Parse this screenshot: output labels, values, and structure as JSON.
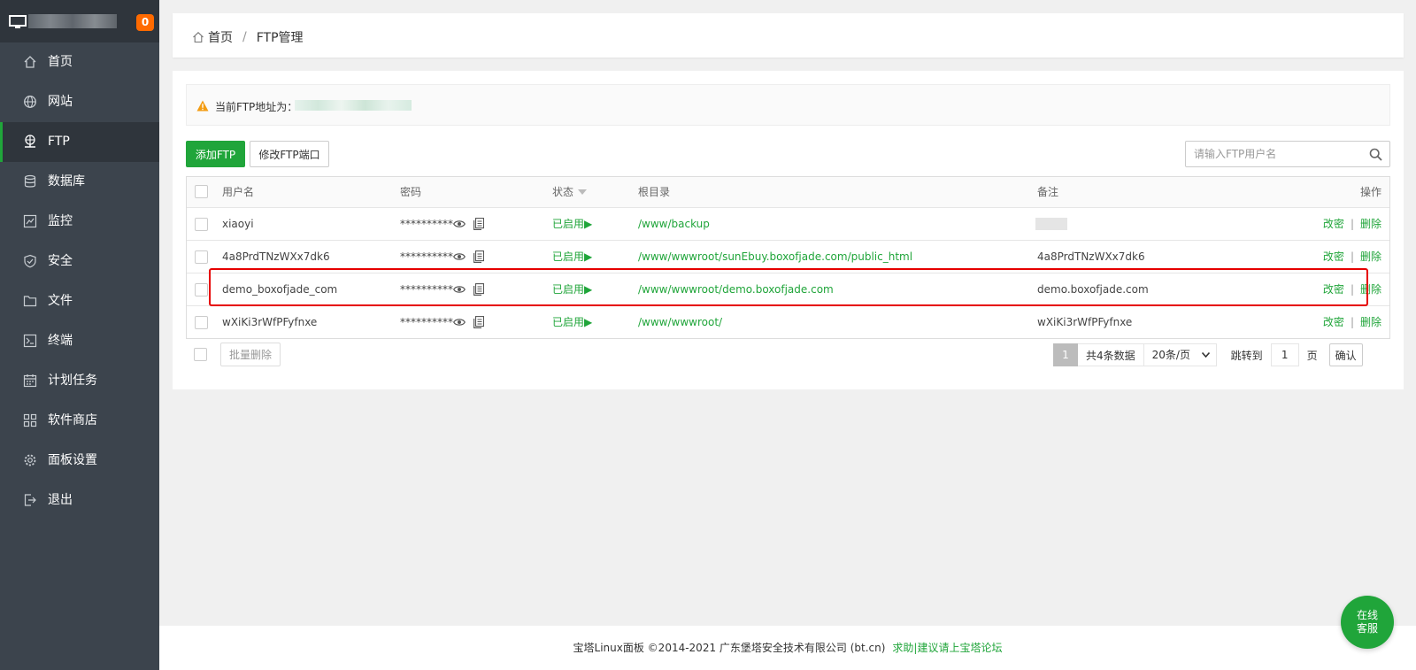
{
  "sidebar": {
    "badge": "0",
    "items": [
      {
        "label": "首页",
        "icon": "home-icon"
      },
      {
        "label": "网站",
        "icon": "globe-icon"
      },
      {
        "label": "FTP",
        "icon": "ftp-icon",
        "active": true
      },
      {
        "label": "数据库",
        "icon": "database-icon"
      },
      {
        "label": "监控",
        "icon": "monitor-chart-icon"
      },
      {
        "label": "安全",
        "icon": "shield-icon"
      },
      {
        "label": "文件",
        "icon": "folder-icon"
      },
      {
        "label": "终端",
        "icon": "terminal-icon"
      },
      {
        "label": "计划任务",
        "icon": "calendar-icon"
      },
      {
        "label": "软件商店",
        "icon": "apps-icon"
      },
      {
        "label": "面板设置",
        "icon": "gear-icon"
      },
      {
        "label": "退出",
        "icon": "logout-icon"
      }
    ]
  },
  "breadcrumb": {
    "home": "首页",
    "separator": "/",
    "current": "FTP管理"
  },
  "notice": {
    "label": "当前FTP地址为："
  },
  "toolbar": {
    "add_label": "添加FTP",
    "port_label": "修改FTP端口",
    "search_placeholder": "请输入FTP用户名"
  },
  "table": {
    "headers": {
      "user": "用户名",
      "password": "密码",
      "status": "状态",
      "path": "根目录",
      "note": "备注",
      "ops": "操作"
    },
    "rows": [
      {
        "user": "xiaoyi",
        "password": "**********",
        "status": "已启用",
        "status_arrow": "▶",
        "path": "/www/backup",
        "note": "",
        "edit": "改密",
        "sep": "|",
        "delete": "删除"
      },
      {
        "user": "4a8PrdTNzWXx7dk6",
        "password": "**********",
        "status": "已启用",
        "status_arrow": "▶",
        "path": "/www/wwwroot/sunEbuy.boxofjade.com/public_html",
        "note": "4a8PrdTNzWXx7dk6",
        "edit": "改密",
        "sep": "|",
        "delete": "删除"
      },
      {
        "user": "demo_boxofjade_com",
        "password": "**********",
        "status": "已启用",
        "status_arrow": "▶",
        "path": "/www/wwwroot/demo.boxofjade.com",
        "note": "demo.boxofjade.com",
        "edit": "改密",
        "sep": "|",
        "delete": "删除"
      },
      {
        "user": "wXiKi3rWfPFyfnxe",
        "password": "**********",
        "status": "已启用",
        "status_arrow": "▶",
        "path": "/www/wwwroot/",
        "note": "wXiKi3rWfPFyfnxe",
        "edit": "改密",
        "sep": "|",
        "delete": "删除"
      }
    ]
  },
  "bottom": {
    "batch_delete": "批量删除",
    "page_current": "1",
    "total": "共4条数据",
    "page_size": "20条/页",
    "jump_label": "跳转到",
    "jump_value": "1",
    "page_unit": "页",
    "confirm": "确认"
  },
  "footer": {
    "copyright": "宝塔Linux面板 ©2014-2021 广东堡塔安全技术有限公司 (bt.cn)",
    "link": "求助|建议请上宝塔论坛"
  },
  "service": {
    "line1": "在线",
    "line2": "客服"
  },
  "colors": {
    "accent": "#20a53a",
    "sidebar": "#3c444d",
    "badge": "#ff6a00",
    "highlight": "#e60000"
  }
}
